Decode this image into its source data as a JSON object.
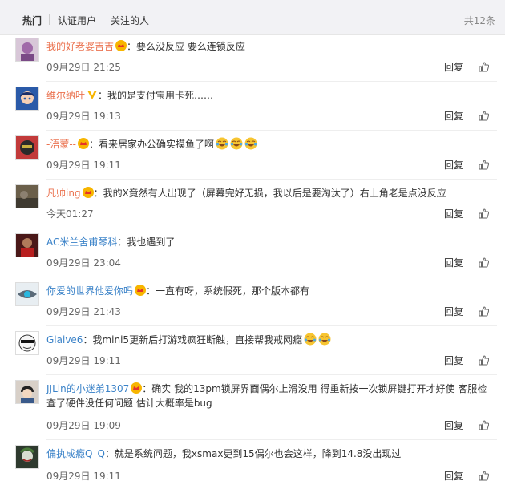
{
  "tabs": [
    "热门",
    "认证用户",
    "关注的人"
  ],
  "total": "共12条",
  "reply_label": "回复",
  "comments": [
    {
      "user": "我的好老婆吉吉",
      "text": "要么没反应 要么连锁反应",
      "time": "09月29日 21:25"
    },
    {
      "user": "维尔纳叶",
      "text": "我的是支付宝用卡死……",
      "time": "09月29日 19:13"
    },
    {
      "user": "-浯蒙--",
      "text": "看来居家办公确实摸鱼了啊",
      "time": "09月29日 19:11"
    },
    {
      "user": "凡帅ing",
      "text": "我的X竟然有人出现了（屏幕完好无损，我以后是要淘汰了）右上角老是点没反应",
      "time": "今天01:27"
    },
    {
      "user": "AC米兰舍甫琴科",
      "text": "我也遇到了",
      "time": "09月29日 23:04"
    },
    {
      "user": "你爱的世界他爱你吗",
      "text": "一直有呀，系统假死，那个版本都有",
      "time": "09月29日 21:43"
    },
    {
      "user": "Glaive6",
      "text": "我mini5更新后打游戏疯狂断触，直接帮我戒网瘾",
      "time": "09月29日 19:11"
    },
    {
      "user": "JJLin的小迷弟1307",
      "text": "确实 我的13pm锁屏界面偶尔上滑没用 得重新按一次锁屏键打开才好使 客服检查了硬件没任何问题 估计大概率是bug",
      "time": "09月29日 19:09"
    },
    {
      "user": "偏执成瘾Q_Q",
      "text": "就是系统问题，我xsmax更到15偶尔也会这样，降到14.8没出现过",
      "time": "09月29日 19:11"
    }
  ]
}
